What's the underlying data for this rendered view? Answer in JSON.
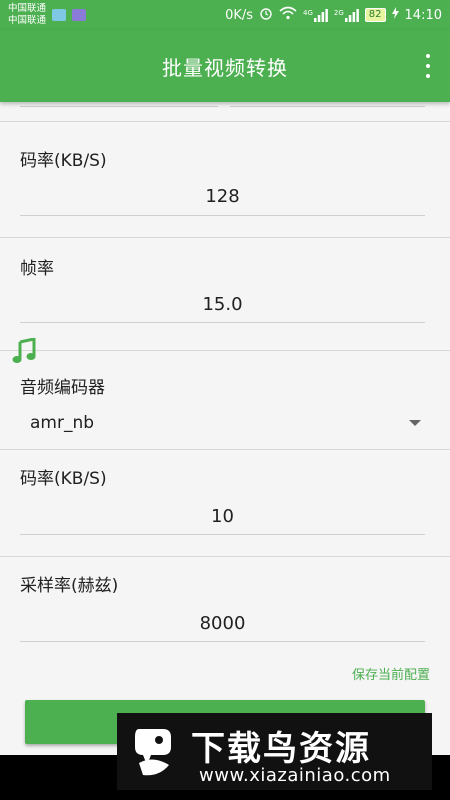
{
  "status_bar": {
    "carrier_1": "中国联通",
    "carrier_2": "中国联通",
    "speed": "0K/s",
    "net_4g": "4G",
    "net_2g": "2G",
    "battery": "82",
    "time": "14:10"
  },
  "app_bar": {
    "title": "批量视频转换"
  },
  "video": {
    "bitrate_label": "码率(KB/S)",
    "bitrate_value": "128",
    "framerate_label": "帧率",
    "framerate_value": "15.0"
  },
  "audio": {
    "section_icon": "music-note-icon",
    "encoder_label": "音频编码器",
    "encoder_value": "amr_nb",
    "bitrate_label": "码率(KB/S)",
    "bitrate_value": "10",
    "samplerate_label": "采样率(赫兹)",
    "samplerate_value": "8000"
  },
  "actions": {
    "save_config": "保存当前配置"
  },
  "watermark": {
    "title": "下载鸟资源",
    "url": "www.xiazainiao.com"
  },
  "colors": {
    "primary": "#4caf50",
    "link": "#4caf50"
  }
}
